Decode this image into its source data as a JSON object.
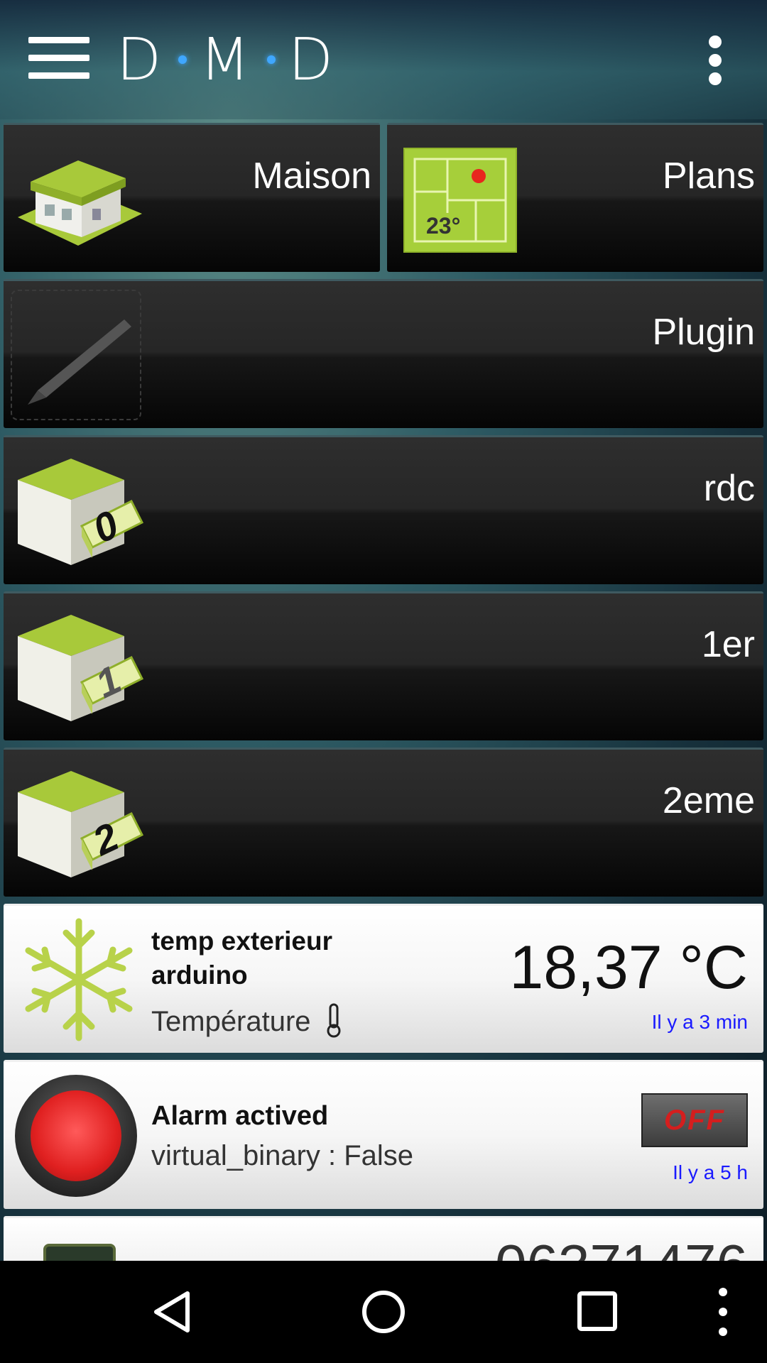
{
  "header": {
    "logo_letters": [
      "D",
      "M",
      "D"
    ]
  },
  "tiles": [
    {
      "id": "maison",
      "label": "Maison"
    },
    {
      "id": "plans",
      "label": "Plans",
      "plan_temp": "23°"
    },
    {
      "id": "plugin",
      "label": "Plugin"
    },
    {
      "id": "rdc",
      "label": "rdc",
      "floor": "0"
    },
    {
      "id": "1er",
      "label": "1er",
      "floor": "1"
    },
    {
      "id": "2eme",
      "label": "2eme",
      "floor": "2"
    }
  ],
  "cards": [
    {
      "name": "temp exterieur arduino",
      "name_line1": "temp exterieur",
      "name_line2": "arduino",
      "type": "Température",
      "value": "18,37 °C",
      "time": "Il y a 3 min"
    },
    {
      "name": "Alarm actived",
      "detail": "virtual_binary : False",
      "button": "OFF",
      "time": "Il y a 5 h"
    },
    {
      "value_partial": "06371476"
    }
  ],
  "colors": {
    "accent_green": "#a8c93a",
    "time_blue": "#1a1aff",
    "alarm_red": "#e02020"
  }
}
